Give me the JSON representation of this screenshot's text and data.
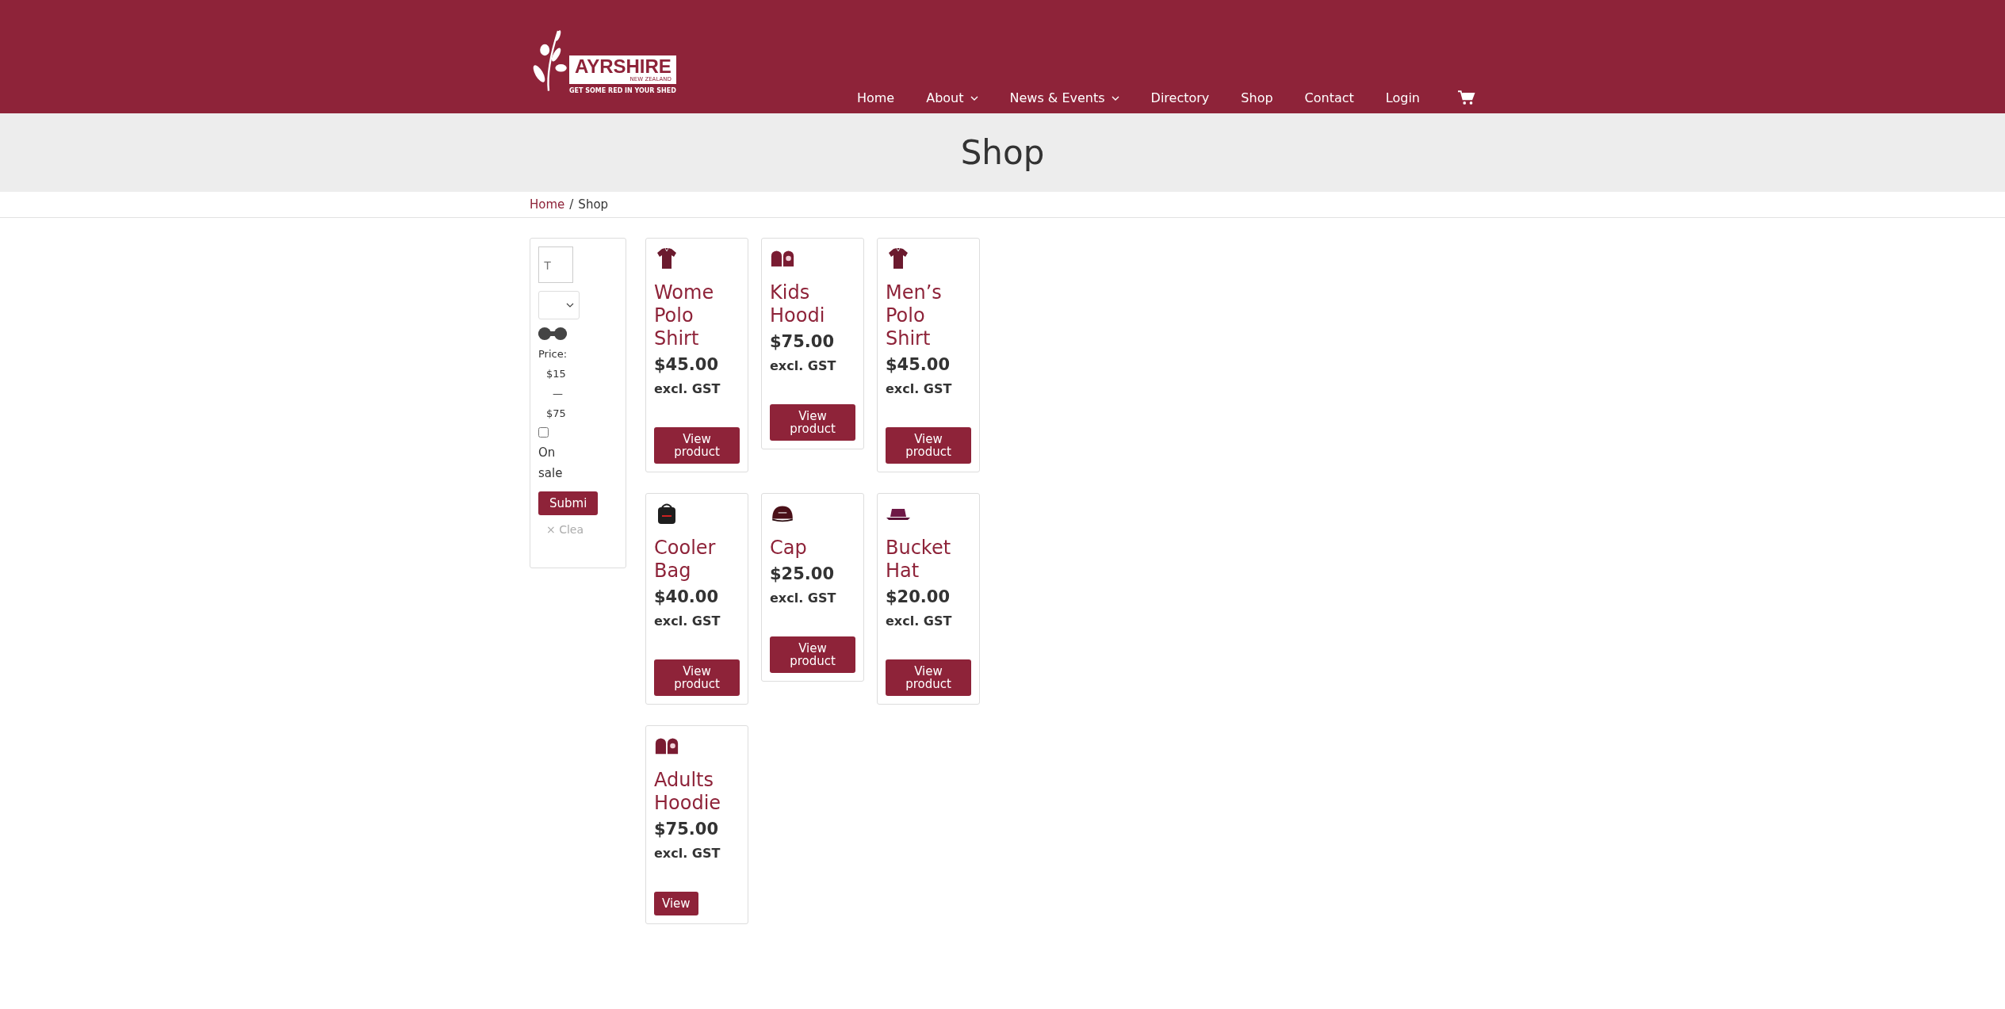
{
  "header": {
    "logo": {
      "name": "AYRSHIRE",
      "sub": "NEW ZEALAND",
      "tagline": "GET SOME RED IN YOUR SHED"
    },
    "nav": [
      {
        "label": "Home",
        "dropdown": false
      },
      {
        "label": "About",
        "dropdown": true
      },
      {
        "label": "News & Events",
        "dropdown": true
      },
      {
        "label": "Directory",
        "dropdown": false
      },
      {
        "label": "Shop",
        "dropdown": false
      },
      {
        "label": "Contact",
        "dropdown": false
      },
      {
        "label": "Login",
        "dropdown": false
      }
    ]
  },
  "page_title": "Shop",
  "breadcrumb": {
    "link": "Home",
    "separator": "/",
    "current": "Shop"
  },
  "filters": {
    "search": {
      "placeholder": "T"
    },
    "price_slider": {
      "level": 1
    },
    "price_label": "Price:",
    "price_min": "$15",
    "price_dash": "—",
    "price_max": "$75",
    "on_sale": {
      "label": "On sale",
      "checked": false
    },
    "submit": "Submi",
    "clear": "× Clea"
  },
  "products": [
    {
      "kind": "shirt",
      "title": "Wome Polo Shirt",
      "price": "$45.00",
      "tax": "excl. GST",
      "button": "View product"
    },
    {
      "kind": "hoodie",
      "title": "Kids Hoodi",
      "price": "$75.00",
      "tax": "excl. GST",
      "button": "View product"
    },
    {
      "kind": "shirt",
      "title": "Men’s Polo Shirt",
      "price": "$45.00",
      "tax": "excl. GST",
      "button": "View product"
    },
    {
      "kind": "bag",
      "title": "Cooler Bag",
      "price": "$40.00",
      "tax": "excl. GST",
      "button": "View product"
    },
    {
      "kind": "cap",
      "title": "Cap",
      "price": "$25.00",
      "tax": "excl. GST",
      "button": "View product"
    },
    {
      "kind": "bucket-hat",
      "title": "Bucket Hat",
      "price": "$20.00",
      "tax": "excl. GST",
      "button": "View product"
    },
    {
      "kind": "hoodie",
      "title": "Adults Hoodie",
      "price": "$75.00",
      "tax": "excl. GST",
      "button": "View"
    }
  ]
}
